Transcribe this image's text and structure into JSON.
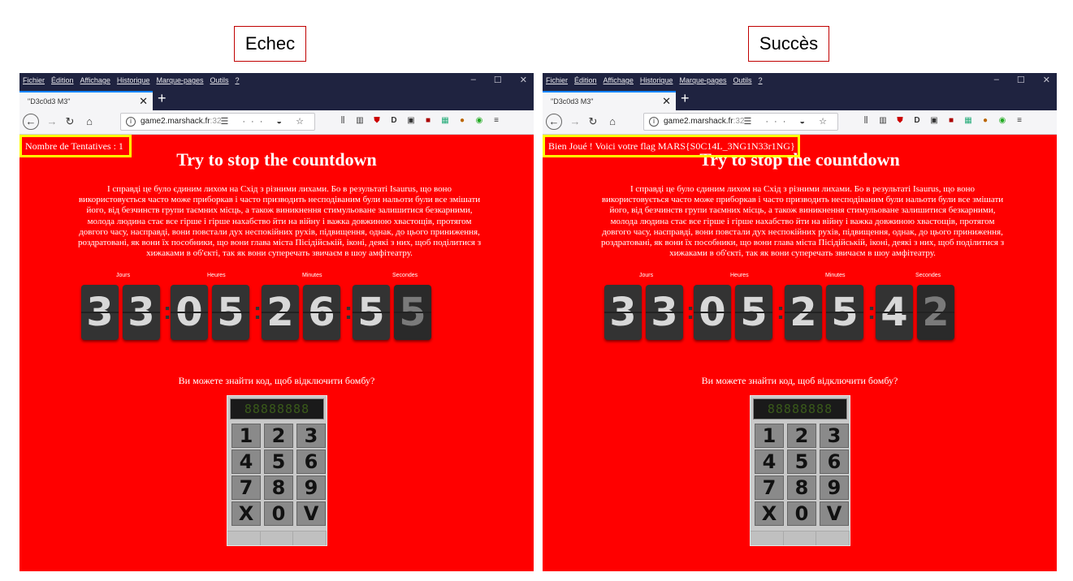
{
  "captions": {
    "left": "Echec",
    "right": "Succès"
  },
  "browser": {
    "menu": [
      "Fichier",
      "Édition",
      "Affichage",
      "Historique",
      "Marque-pages",
      "Outils",
      "?"
    ],
    "window_controls": [
      "–",
      "☐",
      "✕"
    ],
    "tab_title": "\"D3c0d3 M3\"",
    "tab_close": "✕",
    "new_tab": "+",
    "url_host": "game2.marshack.fr",
    "url_port": ":32",
    "nav": {
      "back": "←",
      "forward": "→",
      "reload": "↻",
      "home": "⌂",
      "info": "i"
    },
    "page_actions": "☰ ··· ◒ ☆",
    "toolbar_icons": [
      "library-icon",
      "sidebar-icon",
      "ublock-icon",
      "extension-d-icon",
      "extension-box-icon",
      "extension-red-icon",
      "extension-grid-icon",
      "extension-palette-icon",
      "extension-green-icon",
      "menu-icon"
    ]
  },
  "page": {
    "heading": "Try to stop the countdown",
    "paragraph": "І справді це було єдиним лихом на Схід з різними лихами. Бо в результаті Isaurus, що воно використовується часто може приборкав і часто призводить несподіваним були нальоти були все змішати його, від безчинств групи таємних місць, а також виникнення стимульоване залишитися безкарними, молода людина стає все гірше і гірше нахабство йти на війну і важка довжиною хвастощів, протягом довгого часу, насправді, вони повстали дух неспокійних рухів, підвищення, однак, до цього приниження, роздратовані, як вони їх пособники, що вони глава міста Пісідійській, іконі, деякі з них, щоб поділитися з хижаками в об'єкті, так як вони суперечать звичаєм в шоу амфітеатру.",
    "labels": {
      "days": "Jours",
      "hours": "Heures",
      "minutes": "Minutes",
      "seconds": "Secondes"
    },
    "question": "Ви можете знайти код, щоб відключити бомбу?",
    "keypad_display": "88888888",
    "keys": [
      "1",
      "2",
      "3",
      "4",
      "5",
      "6",
      "7",
      "8",
      "9",
      "X",
      "0",
      "V"
    ]
  },
  "left": {
    "notice": "Nombre de Tentatives : 1",
    "digits": [
      "3",
      "3",
      "0",
      "5",
      "2",
      "6",
      "5",
      "5"
    ]
  },
  "right": {
    "notice": "Bien Joué ! Voici votre flag MARS{S0C14L_3NG1N33r1NG}",
    "digits": [
      "3",
      "3",
      "0",
      "5",
      "2",
      "5",
      "4",
      "2"
    ]
  },
  "colors": {
    "page_bg": "#ff0000",
    "highlight": "#ffff00",
    "titlebar": "#1f2340",
    "caption_border": "#c00000"
  }
}
